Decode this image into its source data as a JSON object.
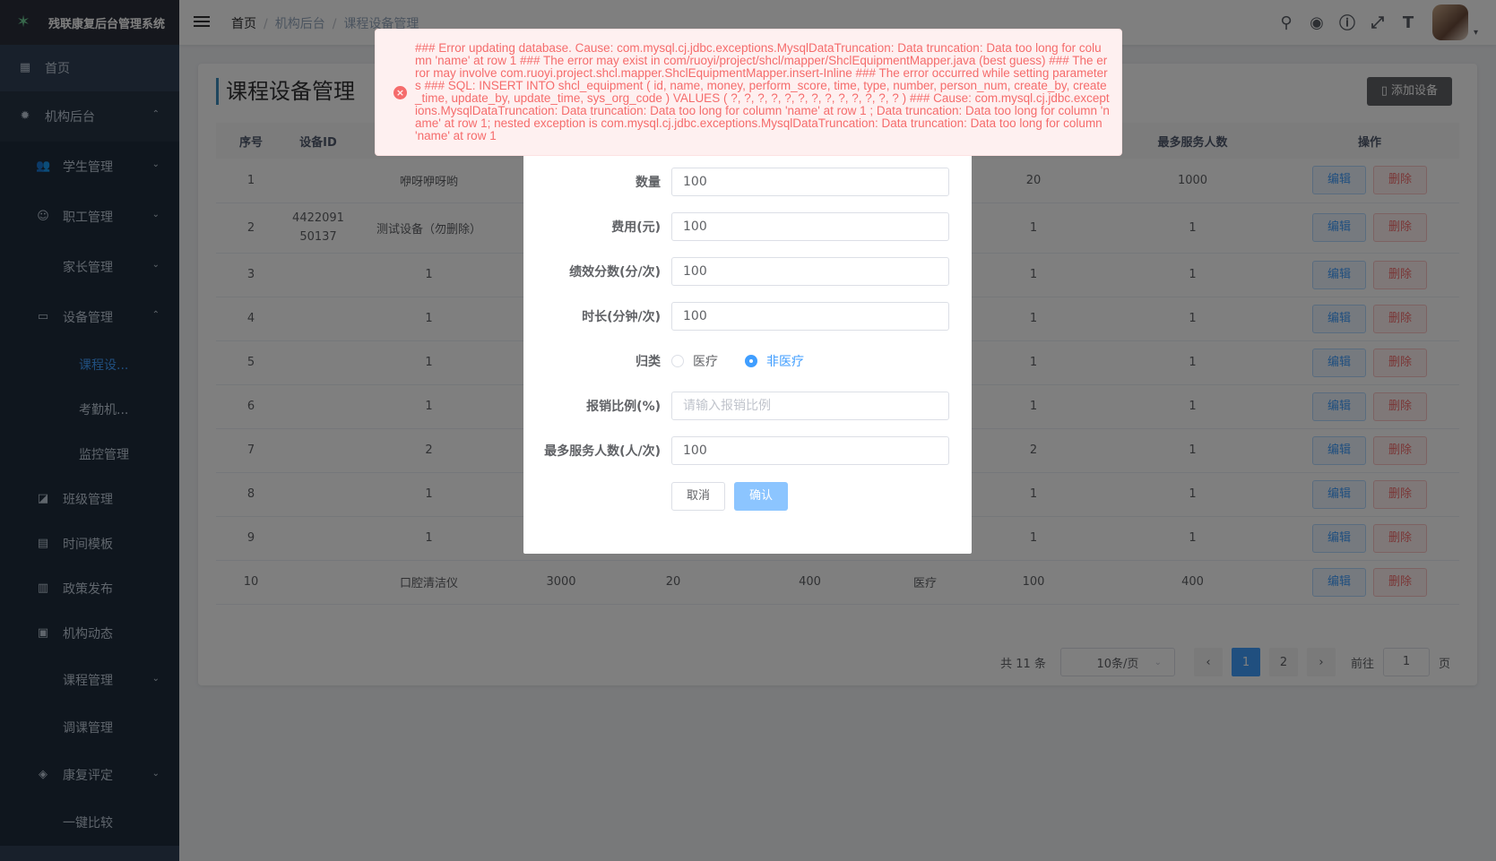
{
  "app": {
    "title": "残联康复后台管理系统"
  },
  "sidebar": {
    "items": [
      {
        "label": "首页",
        "icon": "dashboard-icon"
      },
      {
        "label": "机构后台",
        "icon": "bug-icon"
      },
      {
        "label": "学生管理",
        "icon": "peoples-icon"
      },
      {
        "label": "职工管理",
        "icon": "staff-icon"
      },
      {
        "label": "家长管理"
      },
      {
        "label": "设备管理",
        "icon": "briefcase-icon"
      },
      {
        "label": "课程设..."
      },
      {
        "label": "考勤机..."
      },
      {
        "label": "监控管理"
      },
      {
        "label": "班级管理",
        "icon": "chart-icon"
      },
      {
        "label": "时间模板",
        "icon": "doc-icon"
      },
      {
        "label": "政策发布",
        "icon": "book-icon"
      },
      {
        "label": "机构动态",
        "icon": "message-icon"
      },
      {
        "label": "课程管理"
      },
      {
        "label": "调课管理"
      },
      {
        "label": "康复评定",
        "icon": "layers-icon"
      },
      {
        "label": "一键比较"
      }
    ]
  },
  "navbar": {
    "breadcrumb": [
      "首页",
      "机构后台",
      "课程设备管理"
    ]
  },
  "page": {
    "title": "课程设备管理",
    "add_button": "添加设备"
  },
  "table": {
    "headers": [
      "序号",
      "设备ID",
      "",
      "",
      "",
      "",
      "",
      "",
      "最多服务人数",
      "操作"
    ],
    "edit_label": "编辑",
    "delete_label": "删除",
    "rows": [
      {
        "no": "1",
        "id": "",
        "name": "咿呀咿呀哟",
        "c3": "",
        "c4": "",
        "c5": "",
        "c6": "",
        "c7": "20",
        "max": "1000"
      },
      {
        "no": "2",
        "id": "4422091\n50137",
        "name": "测试设备（勿删除）",
        "c3": "",
        "c4": "",
        "c5": "",
        "c6": "",
        "c7": "1",
        "max": "1"
      },
      {
        "no": "3",
        "id": "",
        "name": "1",
        "c3": "",
        "c4": "",
        "c5": "",
        "c6": "",
        "c7": "1",
        "max": "1"
      },
      {
        "no": "4",
        "id": "",
        "name": "1",
        "c3": "",
        "c4": "",
        "c5": "",
        "c6": "",
        "c7": "1",
        "max": "1"
      },
      {
        "no": "5",
        "id": "",
        "name": "1",
        "c3": "",
        "c4": "",
        "c5": "",
        "c6": "",
        "c7": "1",
        "max": "1"
      },
      {
        "no": "6",
        "id": "",
        "name": "1",
        "c3": "",
        "c4": "",
        "c5": "",
        "c6": "",
        "c7": "1",
        "max": "1"
      },
      {
        "no": "7",
        "id": "",
        "name": "2",
        "c3": "",
        "c4": "",
        "c5": "",
        "c6": "",
        "c7": "2",
        "max": "1"
      },
      {
        "no": "8",
        "id": "",
        "name": "1",
        "c3": "",
        "c4": "",
        "c5": "",
        "c6": "",
        "c7": "1",
        "max": "1"
      },
      {
        "no": "9",
        "id": "",
        "name": "1",
        "c3": "",
        "c4": "",
        "c5": "",
        "c6": "",
        "c7": "1",
        "max": "1"
      },
      {
        "no": "10",
        "id": "",
        "name": "口腔清洁仪",
        "c3": "3000",
        "c4": "20",
        "c5": "400",
        "c6": "医疗",
        "c7": "100",
        "max": "400"
      }
    ]
  },
  "pagination": {
    "total": "共 11 条",
    "page_size": "10条/页",
    "prev": "‹",
    "pages": [
      "1",
      "2"
    ],
    "next": "›",
    "goto_label": "前往",
    "goto_value": "1",
    "goto_suffix": "页"
  },
  "dialog": {
    "fields": [
      {
        "label": "数量",
        "value": "100"
      },
      {
        "label": "费用(元)",
        "value": "100"
      },
      {
        "label": "绩效分数(分/次)",
        "value": "100"
      },
      {
        "label": "时长(分钟/次)",
        "value": "100"
      }
    ],
    "category": {
      "label": "归类",
      "options": [
        "医疗",
        "非医疗"
      ],
      "selected": "非医疗"
    },
    "reimburse": {
      "label": "报销比例(%)",
      "placeholder": "请输入报销比例"
    },
    "max_serve": {
      "label": "最多服务人数(人/次)",
      "value": "100"
    },
    "cancel": "取消",
    "confirm": "确认"
  },
  "toast": {
    "message": "### Error updating database. Cause: com.mysql.cj.jdbc.exceptions.MysqlDataTruncation: Data truncation: Data too long for column 'name' at row 1 ### The error may exist in com/ruoyi/project/shcl/mapper/ShclEquipmentMapper.java (best guess) ### The error may involve com.ruoyi.project.shcl.mapper.ShclEquipmentMapper.insert-Inline ### The error occurred while setting parameters ### SQL: INSERT INTO shcl_equipment ( id, name, money, perform_score, time, type, number, person_num, create_by, create_time, update_by, update_time, sys_org_code ) VALUES ( ?, ?, ?, ?, ?, ?, ?, ?, ?, ?, ?, ?, ? ) ### Cause: com.mysql.cj.jdbc.exceptions.MysqlDataTruncation: Data truncation: Data too long for column 'name' at row 1 ; Data truncation: Data too long for column 'name' at row 1; nested exception is com.mysql.cj.jdbc.exceptions.MysqlDataTruncation: Data truncation: Data too long for column 'name' at row 1",
    "color": "#f56c6c"
  },
  "colors": {
    "sidebar": "#304156",
    "accent": "#409eff",
    "danger": "#f56c6c"
  }
}
